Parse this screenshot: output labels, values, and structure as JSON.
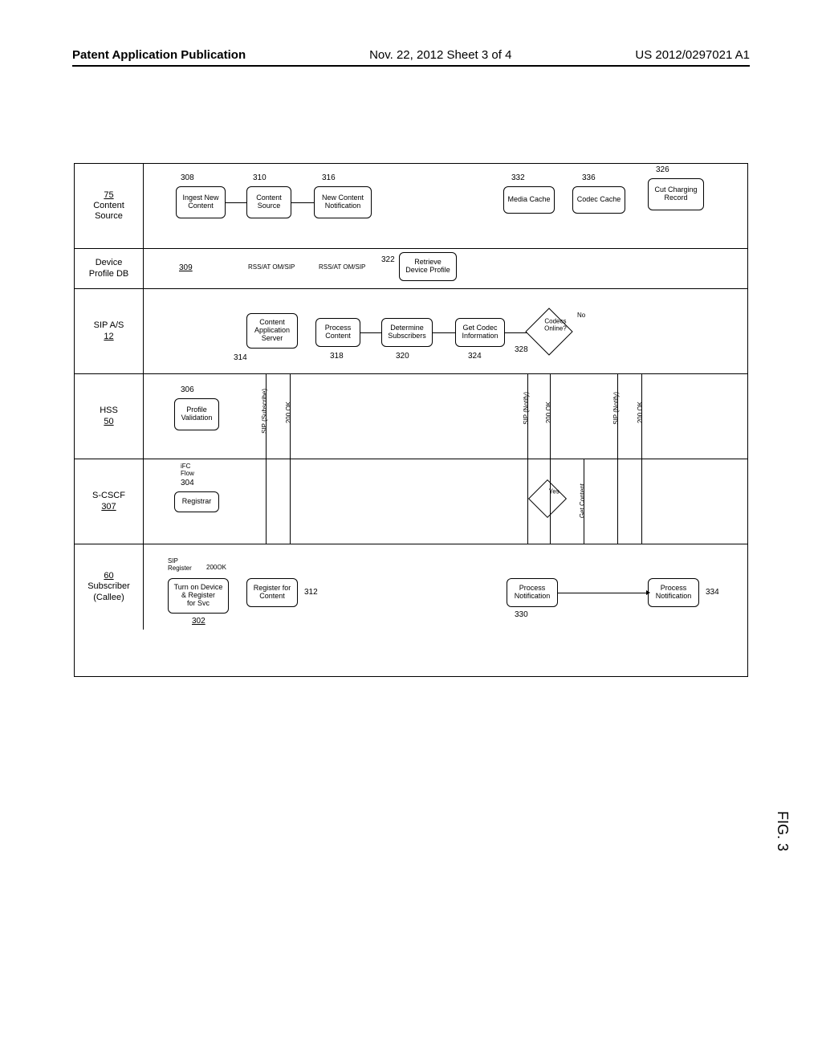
{
  "header": {
    "left": "Patent Application Publication",
    "mid": "Nov. 22, 2012  Sheet 3 of 4",
    "right": "US 2012/0297021 A1"
  },
  "figure_label": "FIG. 3",
  "lanes": {
    "content_source": {
      "title": "Content\nSource",
      "ref": "75"
    },
    "device_profile_db": {
      "title": "Device\nProfile DB",
      "ref": "309"
    },
    "sip_as": {
      "title": "SIP A/S",
      "ref": "12"
    },
    "hss": {
      "title": "HSS",
      "ref": "50"
    },
    "scscf": {
      "title": "S-CSCF",
      "ref": "307"
    },
    "subscriber": {
      "title": "Subscriber\n(Callee)",
      "ref": "60"
    }
  },
  "boxes": {
    "turn_on": "Turn on Device\n& Register\nfor Svc",
    "register_content": "Register for\nContent",
    "registrar": "Registrar",
    "profile_validation": "Profile\nValidation",
    "content_app_server": "Content\nApplication\nServer",
    "ingest_new": "Ingest New\nContent",
    "content_source_box": "Content\nSource",
    "new_content_notif": "New Content\nNotification",
    "process_content": "Process\nContent",
    "determine_subs": "Determine\nSubscribers",
    "retrieve_profile": "Retrieve\nDevice Profile",
    "get_codec": "Get Codec\nInformation",
    "codecs_online": "Codecs\nOnline?",
    "media_cache": "Media Cache",
    "codec_cache": "Codec Cache",
    "cut_charging": "Cut Charging\nRecord",
    "process_notif_1": "Process\nNotification",
    "process_notif_2": "Process\nNotification"
  },
  "msgs": {
    "sip_register": "SIP\nRegister",
    "200ok": "200OK",
    "ifc_flow": "iFC\nFlow",
    "sip_subscribe": "SIP (Subscribe)",
    "200_ok": "200 OK",
    "rss_atom_sip": "RSS/AT OM/SIP",
    "sip_notify": "SIP (Notify)",
    "get_content": "Get Content",
    "yes": "Yes",
    "no": "No"
  },
  "refs": {
    "302": "302",
    "304": "304",
    "306": "306",
    "307": "307",
    "308": "308",
    "309": "309",
    "310": "310",
    "312": "312",
    "314": "314",
    "316": "316",
    "318": "318",
    "320": "320",
    "322": "322",
    "324": "324",
    "326": "326",
    "328": "328",
    "330": "330",
    "332": "332",
    "334": "334",
    "336": "336"
  }
}
